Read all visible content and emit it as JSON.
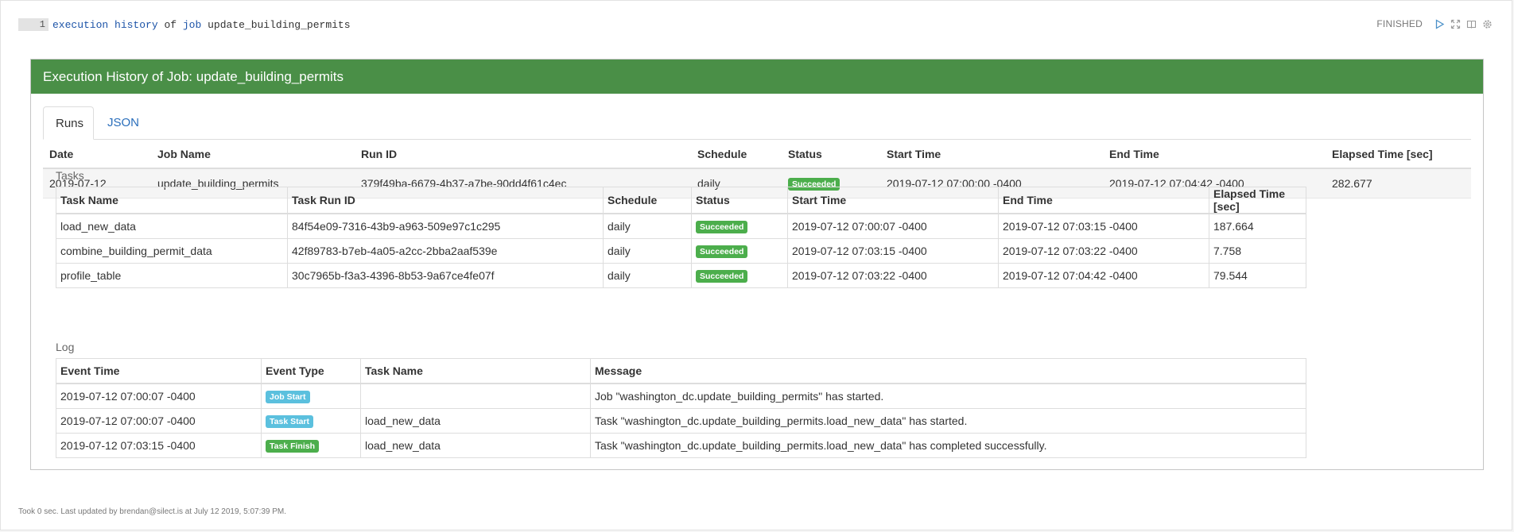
{
  "editor": {
    "line_number": "1",
    "tokens": [
      {
        "text": "execution",
        "kind": "kw"
      },
      {
        "text": "history",
        "kind": "kw"
      },
      {
        "text": "of",
        "kind": "plain"
      },
      {
        "text": "job",
        "kind": "kw"
      },
      {
        "text": "update_building_permits",
        "kind": "plain"
      }
    ]
  },
  "toolbar": {
    "status": "FINISHED",
    "icons": [
      "run-icon",
      "expand-icon",
      "book-icon",
      "settings-icon"
    ]
  },
  "panel": {
    "title": "Execution History of Job: update_building_permits",
    "tabs": [
      "Runs",
      "JSON"
    ],
    "active_tab": "Runs"
  },
  "runs": {
    "headers": [
      "Date",
      "Job Name",
      "Run ID",
      "Schedule",
      "Status",
      "Start Time",
      "End Time",
      "Elapsed Time [sec]"
    ],
    "rows": [
      {
        "date": "2019-07-12",
        "job_name": "update_building_permits",
        "run_id": "379f49ba-6679-4b37-a7be-90dd4f61c4ec",
        "schedule": "daily",
        "status": "Succeeded",
        "start": "2019-07-12 07:00:00 -0400",
        "end": "2019-07-12 07:04:42 -0400",
        "elapsed": "282.677"
      }
    ]
  },
  "tasks": {
    "label": "Tasks",
    "headers": [
      "Task Name",
      "Task Run ID",
      "Schedule",
      "Status",
      "Start Time",
      "End Time",
      "Elapsed Time [sec]"
    ],
    "rows": [
      {
        "name": "load_new_data",
        "run_id": "84f54e09-7316-43b9-a963-509e97c1c295",
        "schedule": "daily",
        "status": "Succeeded",
        "start": "2019-07-12 07:00:07 -0400",
        "end": "2019-07-12 07:03:15 -0400",
        "elapsed": "187.664"
      },
      {
        "name": "combine_building_permit_data",
        "run_id": "42f89783-b7eb-4a05-a2cc-2bba2aaf539e",
        "schedule": "daily",
        "status": "Succeeded",
        "start": "2019-07-12 07:03:15 -0400",
        "end": "2019-07-12 07:03:22 -0400",
        "elapsed": "7.758"
      },
      {
        "name": "profile_table",
        "run_id": "30c7965b-f3a3-4396-8b53-9a67ce4fe07f",
        "schedule": "daily",
        "status": "Succeeded",
        "start": "2019-07-12 07:03:22 -0400",
        "end": "2019-07-12 07:04:42 -0400",
        "elapsed": "79.544"
      }
    ]
  },
  "log": {
    "label": "Log",
    "headers": [
      "Event Time",
      "Event Type",
      "Task Name",
      "Message"
    ],
    "rows": [
      {
        "time": "2019-07-12 07:00:07 -0400",
        "type": "Job Start",
        "type_style": "info",
        "task": "",
        "message": "Job \"washington_dc.update_building_permits\" has started."
      },
      {
        "time": "2019-07-12 07:00:07 -0400",
        "type": "Task Start",
        "type_style": "info",
        "task": "load_new_data",
        "message": "Task \"washington_dc.update_building_permits.load_new_data\" has started."
      },
      {
        "time": "2019-07-12 07:03:15 -0400",
        "type": "Task Finish",
        "type_style": "success",
        "task": "load_new_data",
        "message": "Task \"washington_dc.update_building_permits.load_new_data\" has completed successfully."
      }
    ]
  },
  "footer": {
    "text": "Took 0 sec. Last updated by brendan@silect.is at July 12 2019, 5:07:39 PM."
  },
  "colors": {
    "header_green": "#4a8f47",
    "success": "#4cae4c",
    "info": "#5bc0de",
    "link": "#2a6ebb",
    "keyword": "#1d54a8"
  }
}
